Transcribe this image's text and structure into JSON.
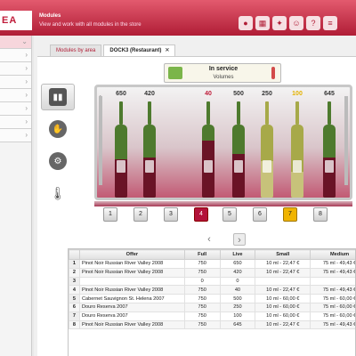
{
  "header": {
    "brand": "EA",
    "title": "Modules",
    "subtitle": "View and work with all modules in the store",
    "icons": [
      "record-icon",
      "grid-icon",
      "bulb-icon",
      "users-icon",
      "help-icon",
      "list-icon"
    ]
  },
  "sidebar": {
    "items": [
      {
        "label": "",
        "active": true,
        "chevron": "⌄"
      },
      {
        "label": "",
        "active": false,
        "chevron": "›"
      },
      {
        "label": "",
        "active": false,
        "chevron": "›"
      },
      {
        "label": "",
        "active": false,
        "chevron": "›"
      },
      {
        "label": "",
        "active": false,
        "chevron": "›"
      },
      {
        "label": "",
        "active": false,
        "chevron": "›"
      },
      {
        "label": "",
        "active": false,
        "chevron": "›"
      },
      {
        "label": "",
        "active": false,
        "chevron": "›"
      }
    ]
  },
  "tabs": [
    {
      "label": "Modules by area",
      "active": false
    },
    {
      "label": "DOCK3 (Restaurant)",
      "active": true,
      "close": "✕"
    }
  ],
  "tools": [
    {
      "icon": "bottles-icon",
      "glyph": "🍾",
      "active": true
    },
    {
      "icon": "dispense-icon",
      "glyph": "✋",
      "active": false
    },
    {
      "icon": "maintenance-icon",
      "glyph": "⚙",
      "active": false
    },
    {
      "icon": "thermometer-icon",
      "glyph": "🌡",
      "active": false
    }
  ],
  "status": {
    "title": "In service",
    "subtitle": "Volumes"
  },
  "cabinet": {
    "corner_mark": "0",
    "slots": [
      {
        "temp": "650",
        "temp_color": "normal",
        "glass": "#4e7a2e",
        "wine": "#6a1326",
        "level": 0.52
      },
      {
        "temp": "420",
        "temp_color": "normal",
        "glass": "#4e7a2e",
        "wine": "#6a1326",
        "level": 0.55
      },
      {
        "temp": "",
        "temp_color": "normal",
        "glass": "",
        "wine": "",
        "level": 0
      },
      {
        "temp": "40",
        "temp_color": "red",
        "glass": "#4e7a2e",
        "wine": "#6a1326",
        "level": 0.78
      },
      {
        "temp": "500",
        "temp_color": "normal",
        "glass": "#4e7a2e",
        "wine": "#6a1326",
        "level": 0.6
      },
      {
        "temp": "250",
        "temp_color": "normal",
        "glass": "#a7a949",
        "wine": "#c7c27a",
        "level": 0.5
      },
      {
        "temp": "100",
        "temp_color": "yellow",
        "glass": "#a7a949",
        "wine": "#c7c27a",
        "level": 0.35
      },
      {
        "temp": "645",
        "temp_color": "normal",
        "glass": "#4e7a2e",
        "wine": "#6a1326",
        "level": 0.55
      }
    ],
    "positions": [
      {
        "label": "1",
        "state": "normal"
      },
      {
        "label": "2",
        "state": "normal"
      },
      {
        "label": "3",
        "state": "normal"
      },
      {
        "label": "4",
        "state": "red"
      },
      {
        "label": "5",
        "state": "normal"
      },
      {
        "label": "6",
        "state": "normal"
      },
      {
        "label": "7",
        "state": "yellow"
      },
      {
        "label": "8",
        "state": "normal"
      }
    ]
  },
  "pager": {
    "prev": "‹",
    "next": "›"
  },
  "table": {
    "columns": [
      "",
      "Offer",
      "Full",
      "Live",
      "Small",
      "Medium"
    ],
    "rows": [
      [
        "1",
        "Pinot Noir Russian River Valley 2008",
        "750",
        "650",
        "10 ml - 22,47 €",
        "75 ml - 49,43 €"
      ],
      [
        "2",
        "Pinot Noir Russian River Valley 2008",
        "750",
        "420",
        "10 ml - 22,47 €",
        "75 ml - 49,43 €"
      ],
      [
        "3",
        "",
        "0",
        "0",
        "",
        ""
      ],
      [
        "4",
        "Pinot Noir Russian River Valley 2008",
        "750",
        "40",
        "10 ml - 22,47 €",
        "75 ml - 49,43 €"
      ],
      [
        "5",
        "Cabernet Sauvignon St. Helena 2007",
        "750",
        "500",
        "10 ml - 60,00 €",
        "75 ml - 60,00 €"
      ],
      [
        "6",
        "Douro Reserva 2007",
        "750",
        "250",
        "10 ml - 60,00 €",
        "75 ml - 60,00 €"
      ],
      [
        "7",
        "Douro Reserva 2007",
        "750",
        "100",
        "10 ml - 60,00 €",
        "75 ml - 60,00 €"
      ],
      [
        "8",
        "Pinot Noir Russian River Valley 2008",
        "750",
        "645",
        "10 ml - 22,47 €",
        "75 ml - 49,43 €"
      ]
    ]
  }
}
